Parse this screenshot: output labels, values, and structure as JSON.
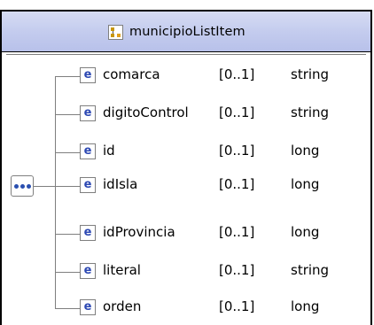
{
  "complex_type": {
    "name": "municipioListItem",
    "icon": "complex-type-icon"
  },
  "compositor": {
    "icon": "sequence-icon"
  },
  "elements": [
    {
      "icon_letter": "e",
      "name": "comarca",
      "occurs": "[0..1]",
      "type": "string"
    },
    {
      "icon_letter": "e",
      "name": "digitoControl",
      "occurs": "[0..1]",
      "type": "string"
    },
    {
      "icon_letter": "e",
      "name": "id",
      "occurs": "[0..1]",
      "type": "long"
    },
    {
      "icon_letter": "e",
      "name": "idIsla",
      "occurs": "[0..1]",
      "type": "long"
    },
    {
      "icon_letter": "e",
      "name": "idProvincia",
      "occurs": "[0..1]",
      "type": "long"
    },
    {
      "icon_letter": "e",
      "name": "literal",
      "occurs": "[0..1]",
      "type": "string"
    },
    {
      "icon_letter": "e",
      "name": "orden",
      "occurs": "[0..1]",
      "type": "long"
    }
  ],
  "colors": {
    "header_gradient_top": "#d6dcf3",
    "header_gradient_bottom": "#b8c1ea",
    "element_icon_letter": "#2c48b3",
    "connector_line": "#7f7f7f",
    "border": "#000000"
  }
}
